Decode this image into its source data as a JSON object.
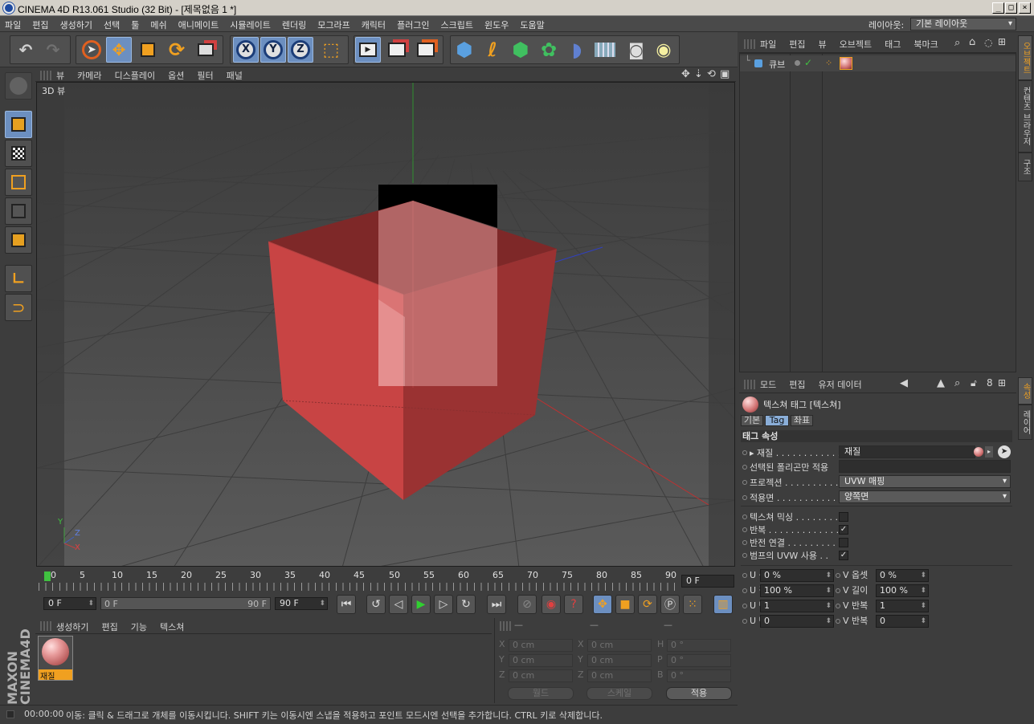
{
  "window": {
    "title": "CINEMA 4D R13.061 Studio (32 Bit) - [제목없음 1 *]",
    "controls": [
      "_",
      "□",
      "×"
    ]
  },
  "menubar": {
    "items": [
      "파일",
      "편집",
      "생성하기",
      "선택",
      "툴",
      "메쉬",
      "애니메이트",
      "시뮬레이트",
      "렌더링",
      "모그라프",
      "캐릭터",
      "플러그인",
      "스크립트",
      "윈도우",
      "도움말"
    ],
    "layout_label": "레이아웃:",
    "layout_value": "기본 레이아웃"
  },
  "toolbar": {
    "icons": [
      "undo-icon",
      "redo-icon",
      "live-select-icon",
      "move-icon",
      "scale-icon",
      "rotate-icon",
      "recent-tools-icon",
      "x-axis-icon",
      "y-axis-icon",
      "z-axis-icon",
      "coordinate-system-icon",
      "render-view-icon",
      "render-picture-viewer-icon",
      "render-settings-icon",
      "cube-primitive-icon",
      "spline-icon",
      "nurbs-icon",
      "array-icon",
      "deformer-icon",
      "floor-icon",
      "camera-icon",
      "light-icon"
    ],
    "axis_labels": [
      "X",
      "Y",
      "Z"
    ]
  },
  "left_tools": [
    "model-mode-icon",
    "texture-mode-icon",
    "points-mode-icon",
    "edges-mode-icon",
    "polygons-mode-icon",
    "axis-mode-icon",
    "snap-icon"
  ],
  "viewport": {
    "menu": [
      "뷰",
      "카메라",
      "디스플레이",
      "옵션",
      "필터",
      "패널"
    ],
    "label": "3D 뷰",
    "axis_labels": [
      "Y",
      "Z",
      "X"
    ],
    "colors": {
      "cube": "#c84444",
      "background": "#4d4d4d",
      "grid": "#3e3e3e"
    }
  },
  "timeline": {
    "ticks": [
      "0",
      "5",
      "10",
      "15",
      "20",
      "25",
      "30",
      "35",
      "40",
      "45",
      "50",
      "55",
      "60",
      "65",
      "70",
      "75",
      "80",
      "85",
      "90"
    ],
    "current_frame": "0 F",
    "start_field": "0 F",
    "range_start": "0 F",
    "range_end": "90 F",
    "end_field": "90 F"
  },
  "material_manager": {
    "menu": [
      "생성하기",
      "편집",
      "기능",
      "텍스쳐"
    ],
    "material_name": "재질"
  },
  "coordinates": {
    "headers": [
      "—",
      "—",
      "—"
    ],
    "rows": [
      {
        "l1": "X",
        "v1": "0 cm",
        "l2": "X",
        "v2": "0 cm",
        "l3": "H",
        "v3": "0 °"
      },
      {
        "l1": "Y",
        "v1": "0 cm",
        "l2": "Y",
        "v2": "0 cm",
        "l3": "P",
        "v3": "0 °"
      },
      {
        "l1": "Z",
        "v1": "0 cm",
        "l2": "Z",
        "v2": "0 cm",
        "l3": "B",
        "v3": "0 °"
      }
    ],
    "world_label": "월드",
    "scale_label": "스케일",
    "apply_label": "적용"
  },
  "status": {
    "time": "00:00:00",
    "message": "이동: 클릭 & 드래그로 개체를 이동시킵니다. SHIFT 키는 이동시엔 스냅을 적용하고 포인트 모드시엔 선택을 추가합니다. CTRL 키로 삭제합니다."
  },
  "object_manager": {
    "menu": [
      "파일",
      "편집",
      "뷰",
      "오브젝트",
      "태그",
      "북마크"
    ],
    "objects": [
      {
        "name": "큐브"
      }
    ]
  },
  "side_tabs_top": [
    "오브젝트",
    "컨텐츠 브라우저",
    "구조"
  ],
  "side_tabs_bottom": [
    "속성",
    "레이어"
  ],
  "attributes": {
    "menu": [
      "모드",
      "편집",
      "유저 데이터"
    ],
    "header": "텍스쳐 태그 [텍스쳐]",
    "tabs": [
      "기본",
      "Tag",
      "좌표"
    ],
    "section": "태그 속성",
    "material_label": "재질 . . . . . . . . . . . .",
    "material_value": "재질",
    "selection_label": "선택된 폴리곤만 적용",
    "selection_value": "",
    "projection_label": "프로젝션 . . . . . . . . . .",
    "projection_value": "UVW 매핑",
    "side_label": "적용면 . . . . . . . . . . . .",
    "side_value": "양쪽면",
    "mix_label": "텍스쳐 믹싱 . . . . . . . .",
    "mix_checked": false,
    "tile_label": "반복 . . . . . . . . . . . . . .",
    "tile_checked": true,
    "seamless_label": "반전 연결 . . . . . . . . . .",
    "seamless_checked": false,
    "bump_label": "범프의 UVW 사용 . .",
    "bump_checked": true,
    "offset_u_label": "U 옵셋",
    "offset_u": "0 %",
    "offset_v_label": "V 옵셋",
    "offset_v": "0 %",
    "length_u_label": "U 길이",
    "length_u": "100 %",
    "length_v_label": "V 길이",
    "length_v": "100 %",
    "tiles_u_label": "U 반복",
    "tiles_u": "1",
    "tiles_v_label": "V 반복",
    "tiles_v": "1",
    "repet_u_label": "U 반복",
    "repet_u": "0",
    "repet_v_label": "V 반복",
    "repet_v": "0"
  }
}
